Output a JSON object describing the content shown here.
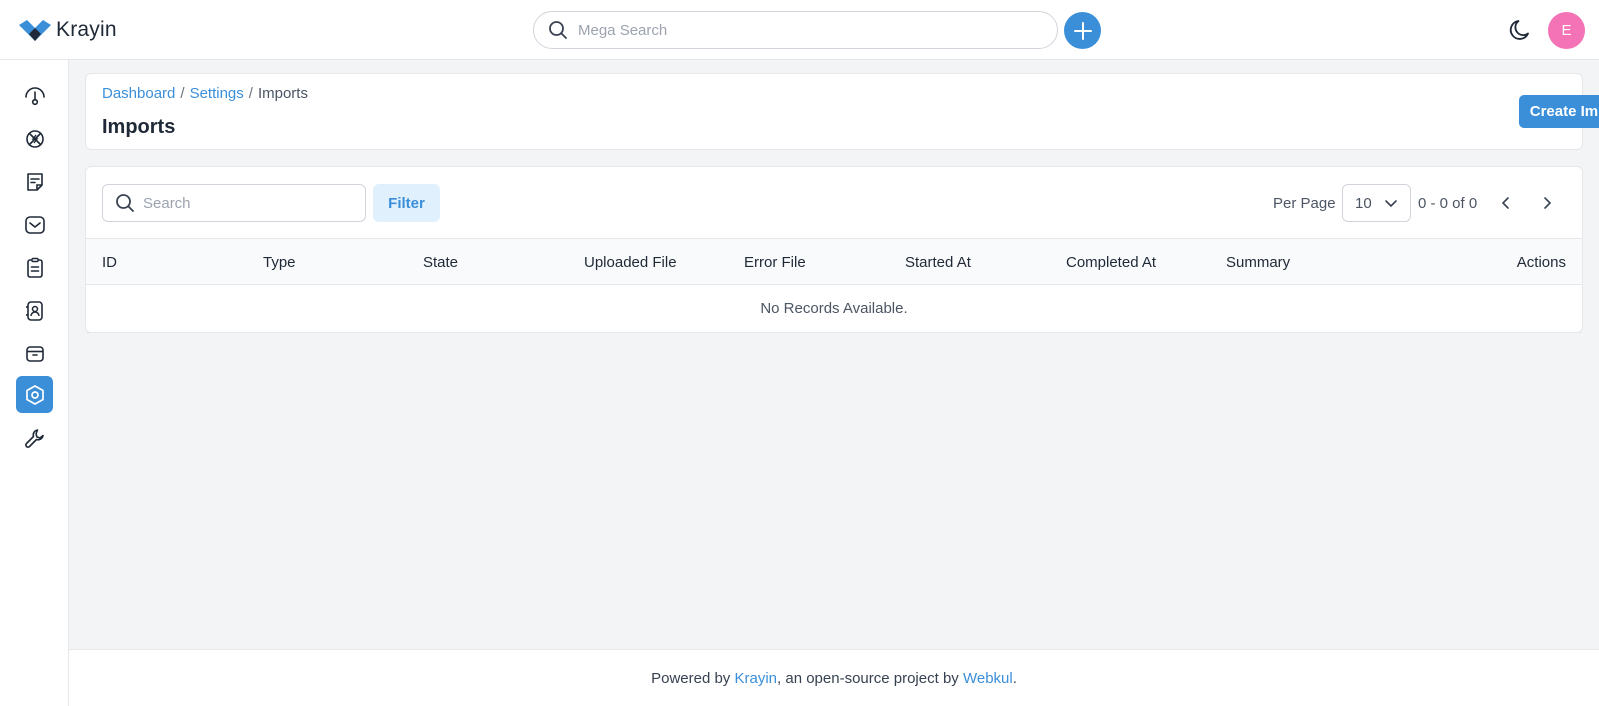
{
  "header": {
    "logo_text": "Krayin",
    "search_placeholder": "Mega Search",
    "avatar_letter": "E",
    "accent_color": "#3b8fd9"
  },
  "sidebar": {
    "items": [
      {
        "icon": "dashboard-icon",
        "active": false
      },
      {
        "icon": "leads-icon",
        "active": false
      },
      {
        "icon": "quotes-icon",
        "active": false
      },
      {
        "icon": "mail-icon",
        "active": false
      },
      {
        "icon": "activities-icon",
        "active": false
      },
      {
        "icon": "contacts-icon",
        "active": false
      },
      {
        "icon": "products-icon",
        "active": false
      },
      {
        "icon": "settings-icon",
        "active": true
      },
      {
        "icon": "configuration-icon",
        "active": false
      }
    ]
  },
  "page": {
    "breadcrumb": {
      "dashboard": "Dashboard",
      "settings": "Settings",
      "separator": "/",
      "current": "Imports"
    },
    "title": "Imports",
    "create_button": "Create Import"
  },
  "datagrid": {
    "search_placeholder": "Search",
    "filter_label": "Filter",
    "per_page_label": "Per Page",
    "per_page_value": "10",
    "page_info": "0 - 0 of 0",
    "columns": [
      "ID",
      "Type",
      "State",
      "Uploaded File",
      "Error File",
      "Started At",
      "Completed At",
      "Summary",
      "Actions"
    ],
    "empty_message": "No Records Available."
  },
  "footer": {
    "prefix": "Powered by",
    "krayin_link": "Krayin",
    "middle": ", an open-source project by",
    "webkul_link": "Webkul",
    "suffix": "."
  }
}
